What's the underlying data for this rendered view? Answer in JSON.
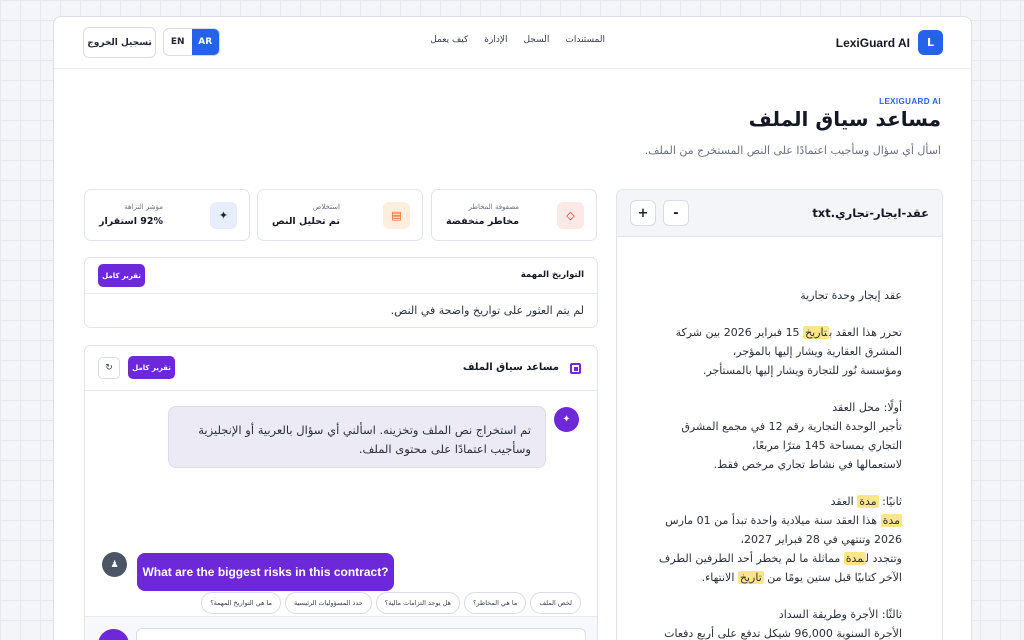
{
  "header": {
    "brand": "LexiGuard AI",
    "logo_letter": "L",
    "nav": [
      "المستندات",
      "السجل",
      "الإدارة",
      "كيف يعمل"
    ],
    "lang_ar": "AR",
    "lang_en": "EN",
    "logout": "تسجيل الخروج"
  },
  "hero": {
    "eyebrow": "LEXIGUARD AI",
    "title": "مساعد سياق الملف",
    "subtitle": "اسأل أي سؤال وسأجيب اعتمادًا على النص المستخرج من الملف."
  },
  "stats": [
    {
      "label": "مصفوفة المخاطر",
      "value": "مخاطر منخفضة",
      "icon": "diamond-icon",
      "color": "#dc2626"
    },
    {
      "label": "استخلاص",
      "value": "تم تحليل النص",
      "icon": "document-icon",
      "color": "#ea580c"
    },
    {
      "label": "مؤشر النزاهة",
      "value": "92% استقرار",
      "icon": "sparkle-icon",
      "color": "#1f2433"
    }
  ],
  "dates": {
    "title": "التواريخ المهمة",
    "button": "تقرير كامل",
    "empty": "لم يتم العثور على تواريخ واضحة في النص."
  },
  "assistant": {
    "title": "مساعد سياق الملف",
    "button": "تقرير كامل",
    "refresh_icon": "↻",
    "bot_message_line1": "تم استخراج نص الملف وتخزينه. اسألني أي سؤال بالعربية أو الإنجليزية",
    "bot_message_line2": "وسأجيب اعتمادًا على محتوى الملف.",
    "user_message": "What are the biggest risks in this contract?",
    "chips": [
      "لخص الملف",
      "ما هي المخاطر؟",
      "هل يوجد التزامات مالية؟",
      "حدد المسؤوليات الرئيسية",
      "ما هي التواريخ المهمة؟"
    ]
  },
  "document": {
    "filename": "عقد-ايجار-تجاري.txt",
    "zoom_in": "+",
    "zoom_out": "-",
    "heading": "عقد إيجار وحدة تجارية",
    "p1_a": "تحرر هذا العقد ب",
    "p1_hl": "تاريخ",
    "p1_b": " 15 فبراير 2026 بين شركة",
    "p1_l2": "المشرق العقارية ويشار إليها بالمؤجر،",
    "p1_l3": "ومؤسسة نُور للتجارة ويشار إليها بالمستأجر.",
    "s1_title": "أولًا: محل العقد",
    "s1_l1": "تأجير الوحدة التجارية رقم 12 في مجمع المشرق",
    "s1_l2": "التجاري بمساحة 145 مترًا مربعًا،",
    "s1_l3": "لاستعمالها في نشاط تجاري مرخص فقط.",
    "s2_title_a": "ثانيًا: ",
    "s2_title_hl": "مدة",
    "s2_title_b": " العقد",
    "s2_l1_hl": "مدة",
    "s2_l1_b": " هذا العقد سنة ميلادية واحدة تبدأ من 01 مارس",
    "s2_l2": "2026 وتنتهي في 28 فبراير 2027،",
    "s2_l3_a": "وتتجدد ل",
    "s2_l3_hl": "مدة",
    "s2_l3_b": " مماثلة ما لم يخطر أحد الطرفين الطرف",
    "s2_l4_a": "الآخر كتابيًا قبل ستين يومًا من ",
    "s2_l4_hl": "تاريخ",
    "s2_l4_b": " الانتهاء.",
    "s3_title": "ثالثًا: الأجرة وطريقة السداد",
    "s3_l1": "الأجرة السنوية 96,000 شيكل تدفع على أربع دفعات"
  }
}
